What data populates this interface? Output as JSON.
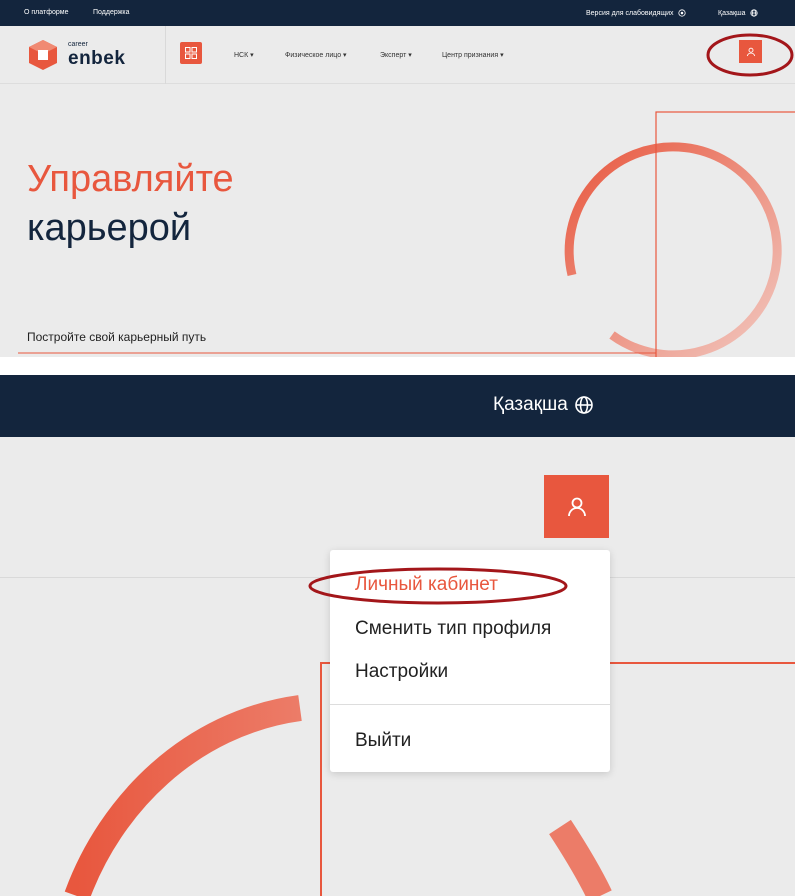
{
  "colors": {
    "brand_dark": "#13253d",
    "accent": "#e8573e",
    "background": "#ebebeb",
    "annotation": "#a3161a"
  },
  "top_bar": {
    "links": [
      "О платформе",
      "Поддержка"
    ],
    "accessibility": "Версия для слабовидящих",
    "language": "Қазақша"
  },
  "logo": {
    "small_word": "career",
    "word": "enbek"
  },
  "nav": {
    "items": [
      "НСК",
      "Физическое лицо",
      "Эксперт",
      "Центр признания"
    ]
  },
  "icons": {
    "apps": "grid-icon",
    "user": "user-icon",
    "globe": "globe-icon",
    "eye": "eye-icon",
    "caret": "caret-down-icon"
  },
  "hero": {
    "title_line1": "Управляйте",
    "title_line2": "карьерой",
    "subtitle": "Постройте свой карьерный путь"
  },
  "zoom": {
    "language": "Қазақша",
    "menu": [
      "Личный кабинет",
      "Сменить тип профиля",
      "Настройки",
      "Выйти"
    ]
  }
}
